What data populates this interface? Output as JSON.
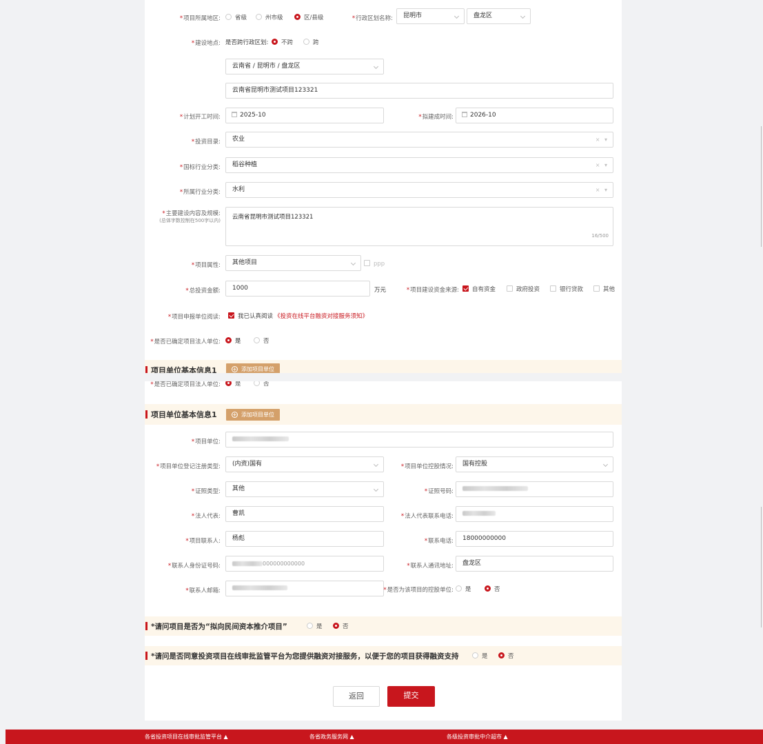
{
  "colors": {
    "accent": "#c8161d",
    "section_bg": "#fdf6ea",
    "add_button": "#d4a06a"
  },
  "panel1": {
    "region": {
      "label": "项目所属地区:",
      "options": [
        "省级",
        "州市级",
        "区/县级"
      ],
      "selected": 2
    },
    "admin_name": {
      "label": "行政区划名称:",
      "city": "昆明市",
      "district": "盘龙区"
    },
    "site": {
      "label": "建设地点:",
      "cross_label": "是否跨行政区划:",
      "options": [
        "不跨",
        "跨"
      ],
      "selected": 0
    },
    "cascade_value": "云南省 / 昆明市 / 盘龙区",
    "address_value": "云南省昆明市测试项目123321",
    "start_time": {
      "label": "计划开工时间:",
      "value": "2025-10"
    },
    "finish_time": {
      "label": "拟建成时间:",
      "value": "2026-10"
    },
    "catalog": {
      "label": "投资目录:",
      "value": "农业"
    },
    "national_industry": {
      "label": "国标行业分类:",
      "value": "稻谷种植"
    },
    "industry": {
      "label": "所属行业分类:",
      "value": "水利"
    },
    "content": {
      "label": "主要建设内容及规模:",
      "hint": "(总体字数控制在500字以内)",
      "value": "云南省昆明市测试项目123321",
      "count": "16/500"
    },
    "attribute": {
      "label": "项目属性:",
      "value": "其他项目",
      "ppp": "ppp"
    },
    "total": {
      "label": "总投资金额:",
      "value": "1000",
      "unit": "万元"
    },
    "funding": {
      "label": "项目建设资金来源:",
      "options": [
        "自有资金",
        "政府投资",
        "银行贷款",
        "其他"
      ],
      "checked": [
        true,
        false,
        false,
        false
      ]
    },
    "read": {
      "label": "项目申报单位阅读:",
      "text": "我已认真阅读",
      "link": "《投资在线平台融资对接服务须知》"
    },
    "legal_confirm": {
      "label": "是否已确定项目法人单位:",
      "options": [
        "是",
        "否"
      ],
      "selected": 0
    },
    "section_title": "项目单位基本信息1",
    "add_label": "添加项目单位"
  },
  "panel2": {
    "legal_confirm_partial": "是否已确定项目法人单位:",
    "section_title": "项目单位基本信息1",
    "add_label": "添加项目单位",
    "unit": {
      "label": "项目单位:"
    },
    "reg_type": {
      "label": "项目单位登记注册类型:",
      "value": "(内资)国有"
    },
    "holding": {
      "label": "项目单位控股情况:",
      "value": "国有控股"
    },
    "cert_type": {
      "label": "证照类型:",
      "value": "其他"
    },
    "cert_no": {
      "label": "证照号码:"
    },
    "legal_rep": {
      "label": "法人代表:",
      "value": "曹凯"
    },
    "legal_phone": {
      "label": "法人代表联系电话:"
    },
    "contact": {
      "label": "项目联系人:",
      "value": "杨彪"
    },
    "contact_phone": {
      "label": "联系电话:",
      "value": "18000000000"
    },
    "contact_id": {
      "label": "联系人身份证号码:",
      "value": "000000000000"
    },
    "contact_addr": {
      "label": "联系人通讯地址:",
      "value": "盘龙区"
    },
    "email": {
      "label": "联系人邮箱:"
    },
    "is_holding": {
      "label": "是否为该项目的控股单位:",
      "options": [
        "是",
        "否"
      ],
      "selected": 1
    },
    "q1": {
      "title": "*请问项目是否为“拟向民间资本推介项目”",
      "options": [
        "是",
        "否"
      ],
      "selected": 1
    },
    "q2": {
      "title": "*请问是否同意投资项目在线审批监管平台为您提供融资对接服务，以便于您的项目获得融资支持",
      "options": [
        "是",
        "否"
      ],
      "selected": 1
    },
    "back": "返回",
    "submit": "提交"
  },
  "footer": [
    "各省投资项目在线审批监管平台 ▲",
    "各省政务服务网 ▲",
    "各级投资审批中介超市 ▲"
  ]
}
